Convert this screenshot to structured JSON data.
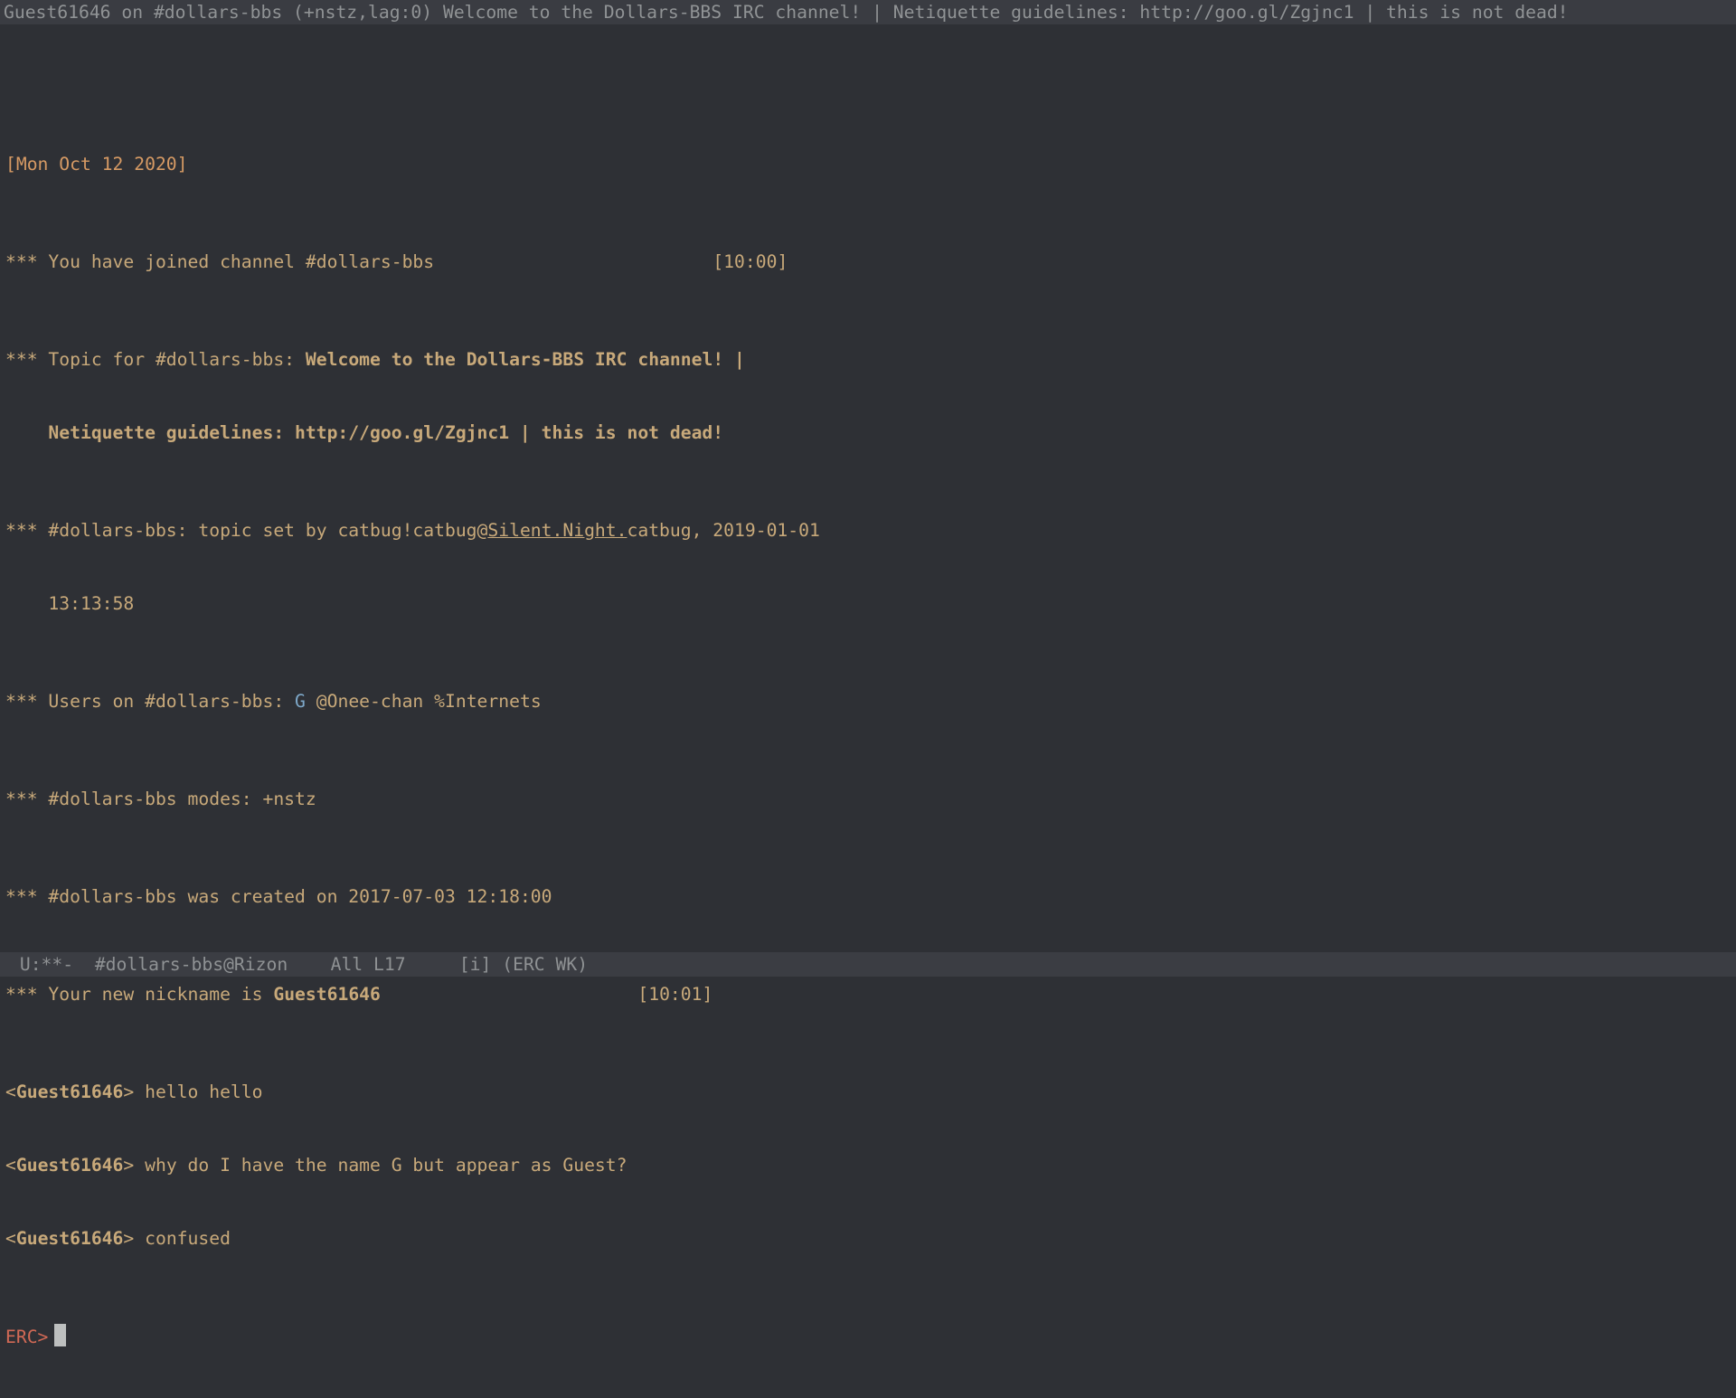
{
  "titlebar": "Guest61646 on #dollars-bbs (+nstz,lag:0) Welcome to the Dollars-BBS IRC channel! | Netiquette guidelines: http://goo.gl/Zgjnc1 | this is not dead!",
  "date_header": "[Mon Oct 12 2020]",
  "stars": "***",
  "lines": {
    "join": "You have joined channel #dollars-bbs",
    "topic_prefix": "Topic for #dollars-bbs: ",
    "topic_body1": "Welcome to the Dollars-BBS IRC channel! |",
    "topic_body2": "Netiquette guidelines: http://goo.gl/Zgjnc1 | this is not dead!",
    "topic_set_pre": "#dollars-bbs: topic set by catbug!catbug@",
    "topic_set_link": "Silent.Night.",
    "topic_set_post": "catbug, 2019-01-01",
    "topic_set_time": "13:13:58",
    "users_pre": "Users on #dollars-bbs: ",
    "users_me": "G",
    "users_rest": " @Onee-chan %Internets",
    "modes": "#dollars-bbs modes: +nstz",
    "created": "#dollars-bbs was created on 2017-07-03 12:18:00",
    "newnick_pre": "Your new nickname is ",
    "newnick": "Guest61646",
    "msg1_nick": "Guest61646",
    "msg1_text": "hello hello",
    "msg2_nick": "Guest61646",
    "msg2_text": "why do I have the name G but appear as Guest?",
    "msg3_nick": "Guest61646",
    "msg3_text": "confused"
  },
  "timestamps": {
    "t1": "[10:00]",
    "t2": "[10:01]"
  },
  "prompt": "ERC>",
  "modeline": " U:**-  #dollars-bbs@Rizon    All L17     [i] (ERC WK)"
}
